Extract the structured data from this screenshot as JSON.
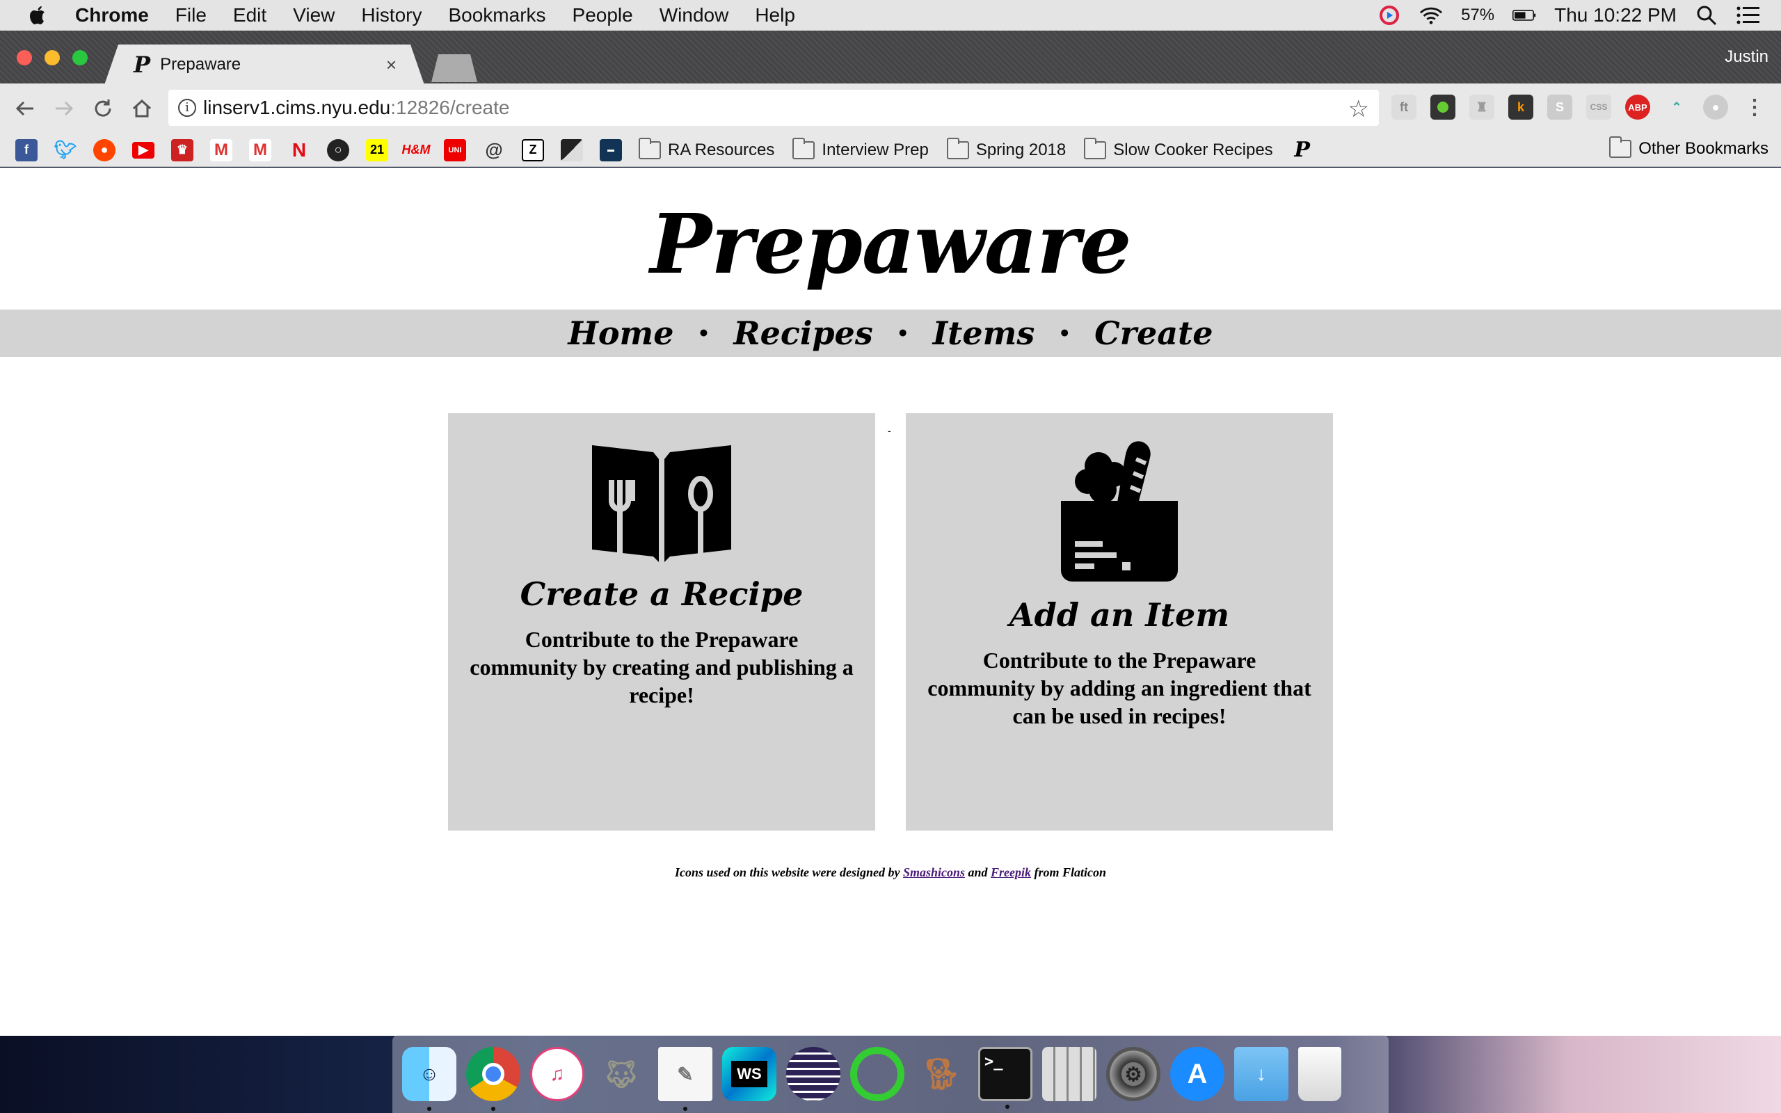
{
  "menubar": {
    "app": "Chrome",
    "items": [
      "File",
      "Edit",
      "View",
      "History",
      "Bookmarks",
      "People",
      "Window",
      "Help"
    ],
    "battery": "57%",
    "clock": "Thu 10:22 PM"
  },
  "window": {
    "tab_title": "Prepaware",
    "tab_favicon": "P",
    "close": "×",
    "profile": "Justin"
  },
  "omnibox": {
    "host": "linserv1.cims.nyu.edu",
    "path": ":12826/create"
  },
  "bookmarks": {
    "folders": [
      "RA Resources",
      "Interview Prep",
      "Spring 2018",
      "Slow Cooker Recipes"
    ],
    "other": "Other Bookmarks"
  },
  "page": {
    "title": "Prepaware",
    "nav": [
      "Home",
      "Recipes",
      "Items",
      "Create"
    ],
    "nav_sep": "•",
    "stray": "-",
    "cards": [
      {
        "title": "Create a Recipe",
        "text": "Contribute to the Prepaware community by creating and publishing a recipe!",
        "icon": "recipe-book-icon"
      },
      {
        "title": "Add an Item",
        "text": "Contribute to the Prepaware community by adding an ingredient that can be used in recipes!",
        "icon": "grocery-bag-icon"
      }
    ],
    "credits": {
      "prefix": "Icons used on this website were designed by",
      "link1": "Smashicons",
      "mid": "and",
      "link2": "Freepik",
      "suffix": "from Flaticon"
    }
  },
  "colors": {
    "nav_bg": "#d3d3d3",
    "card_bg": "#d3d3d3",
    "link": "#4a1b7a"
  }
}
